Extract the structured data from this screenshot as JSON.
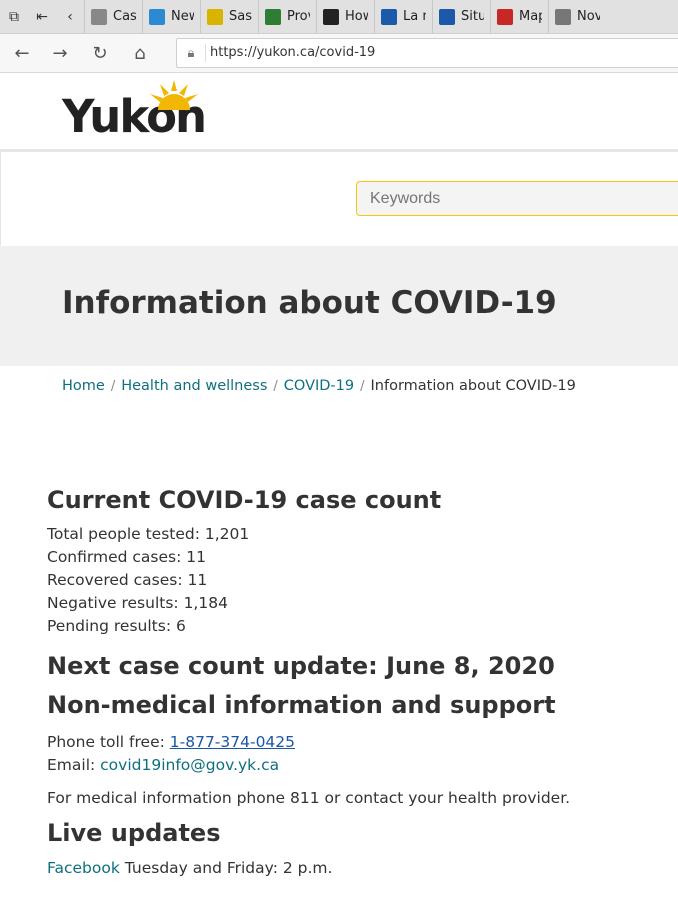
{
  "browser": {
    "tabs": [
      {
        "label": "Case",
        "icon": "page-icon",
        "color": "#888888"
      },
      {
        "label": "New",
        "icon": "new-tab-icon",
        "color": "#2a8bd4"
      },
      {
        "label": "Sask",
        "icon": "wheat-icon",
        "color": "#d8b400"
      },
      {
        "label": "Prov",
        "icon": "flag-icon",
        "color": "#2e7d32"
      },
      {
        "label": "How",
        "icon": "shield-icon",
        "color": "#222222"
      },
      {
        "label": "La m",
        "icon": "fleur-de-lis-icon",
        "color": "#1a5aa8"
      },
      {
        "label": "Situ",
        "icon": "fleur-de-lis-icon",
        "color": "#1a5aa8"
      },
      {
        "label": "Map",
        "icon": "map-icon",
        "color": "#c62828"
      },
      {
        "label": "Nov",
        "icon": "newspaper-icon",
        "color": "#777777"
      }
    ],
    "url": "https://yukon.ca/covid-19"
  },
  "header": {
    "logo_text": "Yukon",
    "search_placeholder": "Keywords"
  },
  "hero": {
    "title": "Information about COVID-19"
  },
  "breadcrumb": {
    "items": [
      "Home",
      "Health and wellness",
      "COVID-19"
    ],
    "current": "Information about COVID-19"
  },
  "case_count": {
    "heading": "Current COVID-19 case count",
    "lines": [
      "Total people tested: 1,201",
      "Confirmed cases: 11",
      "Recovered cases: 11",
      "Negative results: 1,184",
      "Pending results: 6"
    ]
  },
  "next_update": {
    "heading": "Next case count update: June 8, 2020"
  },
  "support": {
    "heading": "Non-medical information and support",
    "phone_label": "Phone toll free: ",
    "phone": "1-877-374-0425",
    "email_label": "Email: ",
    "email": "covid19info@gov.yk.ca",
    "note": "For medical information phone 811 or contact your health provider."
  },
  "live": {
    "heading": "Live updates",
    "link": "Facebook",
    "schedule": " Tuesday and Friday: 2 p.m."
  },
  "colors": {
    "link": "#0f6f80",
    "search_border": "#f2c811",
    "hero_bg": "#f0f0f0"
  }
}
